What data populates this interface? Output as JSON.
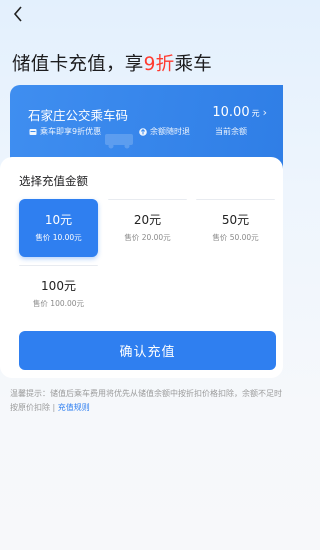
{
  "nav": {
    "back_icon": "chevron-left-icon"
  },
  "headline": {
    "prefix": "储值卡充值，享",
    "discount": "9折",
    "suffix": "乘车"
  },
  "card": {
    "title": "石家庄公交乘车码",
    "balance_value": "10.00",
    "balance_unit": "元",
    "balance_arrow": "›",
    "benefit_left": "乘车即享9折优惠",
    "benefit_mid": "余额随时退",
    "balance_label": "当前余额"
  },
  "recharge": {
    "section_title": "选择充值金额",
    "options": [
      {
        "amount": "10元",
        "price": "售价 10.00元",
        "selected": true
      },
      {
        "amount": "20元",
        "price": "售价 20.00元",
        "selected": false
      },
      {
        "amount": "50元",
        "price": "售价 50.00元",
        "selected": false
      },
      {
        "amount": "100元",
        "price": "售价 100.00元",
        "selected": false
      }
    ],
    "confirm_label": "确认充值"
  },
  "tip": {
    "text": "温馨提示：储值后乘车费用将优先从储值余额中按折扣价格扣除，余额不足时按原价扣除 | ",
    "rule_link": "充值规则"
  },
  "colors": {
    "primary": "#2f7ff0",
    "discount": "#ff3b30"
  }
}
